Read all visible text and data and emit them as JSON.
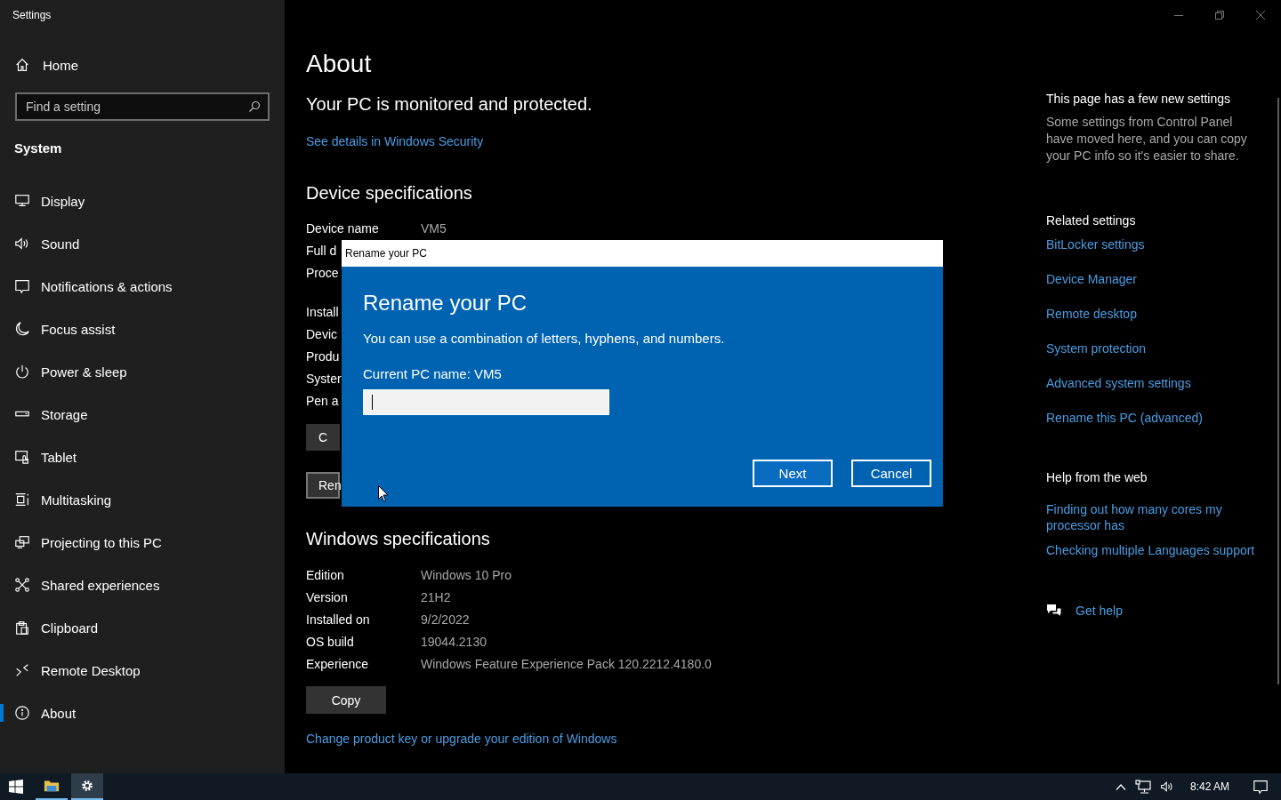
{
  "window": {
    "title": "Settings"
  },
  "sidebar": {
    "home": "Home",
    "search": {
      "placeholder": "Find a setting"
    },
    "section": "System",
    "items": [
      {
        "label": "Display",
        "selected": false
      },
      {
        "label": "Sound",
        "selected": false
      },
      {
        "label": "Notifications & actions",
        "selected": false
      },
      {
        "label": "Focus assist",
        "selected": false
      },
      {
        "label": "Power & sleep",
        "selected": false
      },
      {
        "label": "Storage",
        "selected": false
      },
      {
        "label": "Tablet",
        "selected": false
      },
      {
        "label": "Multitasking",
        "selected": false
      },
      {
        "label": "Projecting to this PC",
        "selected": false
      },
      {
        "label": "Shared experiences",
        "selected": false
      },
      {
        "label": "Clipboard",
        "selected": false
      },
      {
        "label": "Remote Desktop",
        "selected": false
      },
      {
        "label": "About",
        "selected": true
      }
    ]
  },
  "main": {
    "title": "About",
    "security_status": "Your PC is monitored and protected.",
    "security_link": "See details in Windows Security",
    "device_specs": {
      "heading": "Device specifications",
      "groups": [
        [
          {
            "label": "Device name",
            "value": "VM5"
          },
          {
            "label": "Full d"
          },
          {
            "label": "Proce"
          }
        ],
        [
          {
            "label": "Install"
          },
          {
            "label": "Devic"
          },
          {
            "label": "Produ"
          },
          {
            "label": "Syster"
          },
          {
            "label": "Pen a"
          }
        ]
      ],
      "buttons": [
        "C",
        "Ren"
      ]
    },
    "windows_specs": {
      "heading": "Windows specifications",
      "rows": [
        {
          "label": "Edition",
          "value": "Windows 10 Pro"
        },
        {
          "label": "Version",
          "value": "21H2"
        },
        {
          "label": "Installed on",
          "value": "9/2/2022"
        },
        {
          "label": "OS build",
          "value": "19044.2130"
        },
        {
          "label": "Experience",
          "value": "Windows Feature Experience Pack 120.2212.4180.0"
        }
      ],
      "button": "Copy"
    },
    "links": [
      "Change product key or upgrade your edition of Windows"
    ]
  },
  "right_panel": {
    "new_settings": {
      "heading": "This page has a few new settings",
      "text": "Some settings from Control Panel have moved here, and you can copy your PC info so it's easier to share."
    },
    "related": {
      "heading": "Related settings",
      "links": [
        "BitLocker settings",
        "Device Manager",
        "Remote desktop",
        "System protection",
        "Advanced system settings",
        "Rename this PC (advanced)"
      ]
    },
    "help": {
      "heading": "Help from the web",
      "links": [
        "Finding out how many cores my processor has",
        "Checking multiple Languages support"
      ],
      "get_help": "Get help"
    }
  },
  "dialog": {
    "title": "Rename your PC",
    "heading": "Rename your PC",
    "description": "You can use a combination of letters, hyphens, and numbers.",
    "current_name_label": "Current PC name: VM5",
    "buttons": [
      {
        "label": "Next",
        "kind": "primary"
      },
      {
        "label": "Cancel",
        "kind": "secondary"
      }
    ]
  },
  "taskbar": {
    "apps": [
      {
        "selected": false
      },
      {
        "selected": true
      }
    ],
    "clock": "8:42 AM"
  }
}
